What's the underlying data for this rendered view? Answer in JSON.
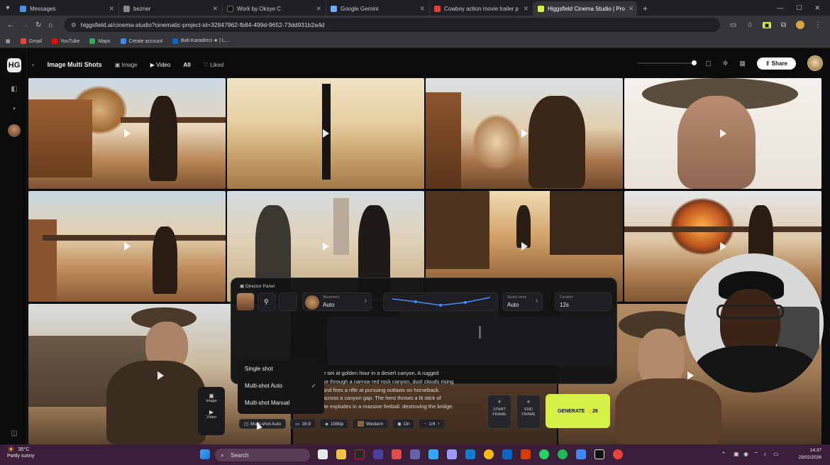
{
  "browser": {
    "tabs": [
      {
        "title": "Messages",
        "color": "#4a90e2"
      },
      {
        "title": "bezner",
        "color": "#888888"
      },
      {
        "title": "Work by Oksye C",
        "color": "#111111"
      },
      {
        "title": "Google Gemini",
        "color": "#6ea8ff"
      },
      {
        "title": "Cowboy action movie trailer p",
        "color": "#e0402f"
      },
      {
        "title": "Higgsfield Cinema Studio | Pro",
        "color": "#d4f245"
      }
    ],
    "url": "higgsfield.ai/cinema-studio?cinematic-project-id=32847962-fb84-499d-9652-73dd931b2a4d",
    "bookmarks": [
      {
        "label": "Gmail",
        "color": "#ea4335"
      },
      {
        "label": "YouTube",
        "color": "#ff0000"
      },
      {
        "label": "Maps",
        "color": "#34a853"
      },
      {
        "label": "Create account",
        "color": "#4285f4"
      },
      {
        "label": "Bati Karaderci ★ | L...",
        "color": "#0a66c2"
      }
    ]
  },
  "app": {
    "logo": "HG",
    "toolbar": {
      "title": "Image Multi Shots",
      "image_label": "Image",
      "video_label": "Video",
      "all_label": "All",
      "liked_label": "Liked"
    },
    "share_label": "Share"
  },
  "director_panel": {
    "title": "Director Panel",
    "movement_label": "Movement",
    "movement_value": "Auto",
    "speed_label": "Speed ramp",
    "speed_value": "Auto",
    "duration_label": "Duration",
    "duration_value": "12s",
    "shot_options": [
      "Single shot",
      "Multi-shot Auto",
      "Multi-shot Manual"
    ],
    "selected_option": "Multi-shot Auto",
    "check": "✓",
    "prompt_lines": [
      "e set at golden hour in a desert canyon. A rugged",
      "se through a narrow red rock canyon, dust clouds rising",
      "and fires a rifle at pursuing outlaws on horseback.",
      "across a canyon gap. The hero throws a lit stick of",
      "ite explodes in a massive fireball. destroving the bridge."
    ],
    "chips": {
      "shot": "Multi-shot Auto",
      "ratio": "16:9",
      "res": "1080p",
      "genre": "Western",
      "sound": "On",
      "count": "1/4"
    },
    "start_frame": "START FRAME",
    "end_frame": "END FRAME",
    "generate_label": "GENERATE",
    "generate_cost": "26",
    "side_image": "Image",
    "side_video": "Video"
  },
  "taskbar": {
    "temp": "35°C",
    "weather": "Partly sunny",
    "search_placeholder": "Search",
    "time": "14:37",
    "date": "23/02/2026"
  }
}
